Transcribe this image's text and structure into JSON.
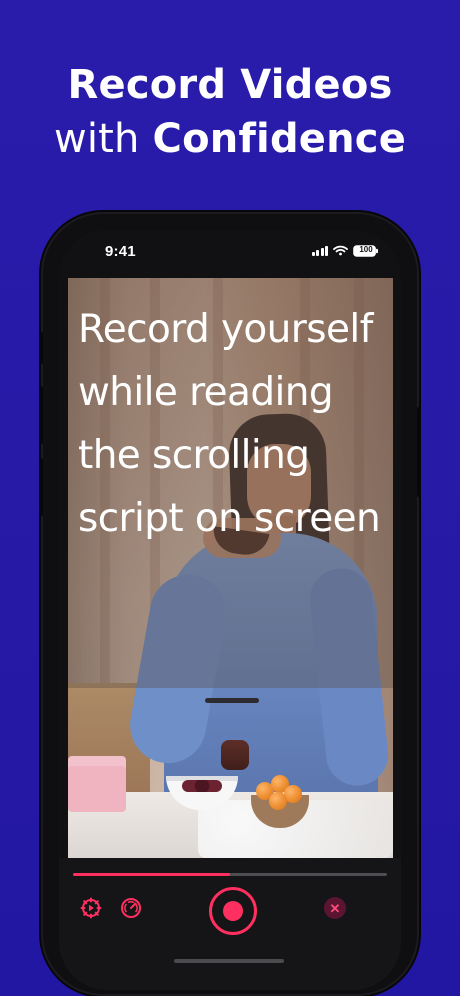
{
  "hero": {
    "line1": "Record Videos",
    "line2_prefix": "with",
    "line2_bold": "Confidence"
  },
  "status_bar": {
    "time": "9:41",
    "battery": "100",
    "icons": [
      "signal-icon",
      "wifi-icon",
      "battery-icon"
    ]
  },
  "teleprompter": {
    "script_text": "Record yourself while reading the scrolling script on screen"
  },
  "progress": {
    "fraction": 0.5
  },
  "controls": [
    {
      "name": "playback-settings-icon"
    },
    {
      "name": "speed-gauge-icon"
    },
    {
      "name": "record-icon"
    },
    {
      "name": "close-icon"
    }
  ],
  "theme": {
    "background": "#2418a3",
    "accent": "#ff2f5f",
    "phone": "#0f0f12"
  }
}
